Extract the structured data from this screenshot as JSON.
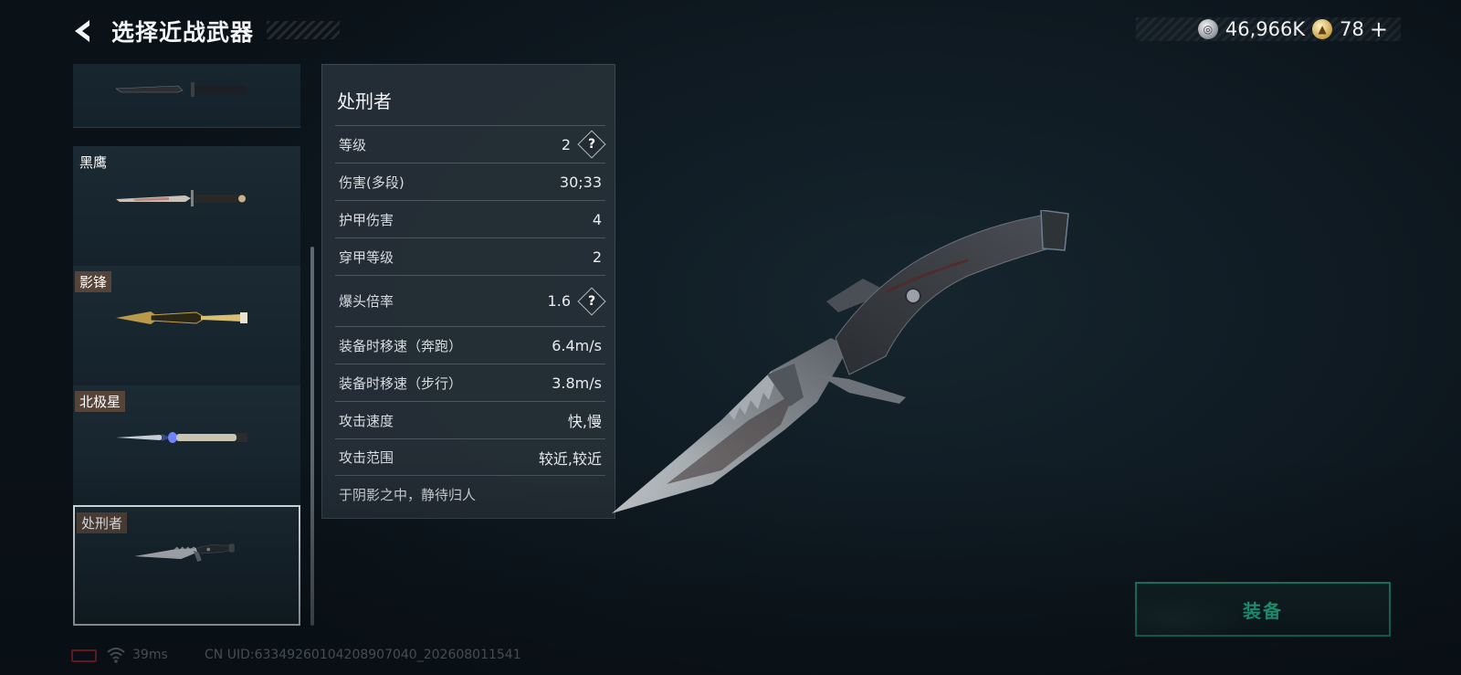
{
  "header": {
    "title": "选择近战武器",
    "back_icon": "back-arrow-icon"
  },
  "currency": {
    "silver": {
      "icon": "silver-coin-icon",
      "value": "46,966K"
    },
    "gold": {
      "icon": "gold-coin-icon",
      "value": "78",
      "plus": "+"
    }
  },
  "weapons": [
    {
      "name": "",
      "selected": false
    },
    {
      "name": "黑鹰",
      "selected": false
    },
    {
      "name": "影锋",
      "selected": false
    },
    {
      "name": "北极星",
      "selected": false
    },
    {
      "name": "处刑者",
      "selected": true
    }
  ],
  "stats": {
    "title": "处刑者",
    "rows": [
      {
        "label": "等级",
        "value": "2",
        "help": "?"
      },
      {
        "label": "伤害(多段)",
        "value": "30;33"
      },
      {
        "label": "护甲伤害",
        "value": "4"
      },
      {
        "label": "穿甲等级",
        "value": "2"
      },
      {
        "label": "爆头倍率",
        "value": "1.6",
        "help": "?"
      },
      {
        "label": "装备时移速（奔跑）",
        "value": "6.4m/s"
      },
      {
        "label": "装备时移速（步行）",
        "value": "3.8m/s"
      },
      {
        "label": "攻击速度",
        "value": "快,慢"
      },
      {
        "label": "攻击范围",
        "value": "较近,较近"
      }
    ],
    "description": "于阴影之中，静待归人"
  },
  "equip_button": {
    "label": "装备"
  },
  "footer": {
    "battery_icon": "battery-icon",
    "wifi_icon": "wifi-icon",
    "ping": "39ms",
    "uid": "CN UID:6334926010420890704​0_202608011541"
  },
  "colors": {
    "accent_green": "#2ee2a6",
    "equip_border": "#18a27a",
    "battery_red": "#d0242a"
  }
}
